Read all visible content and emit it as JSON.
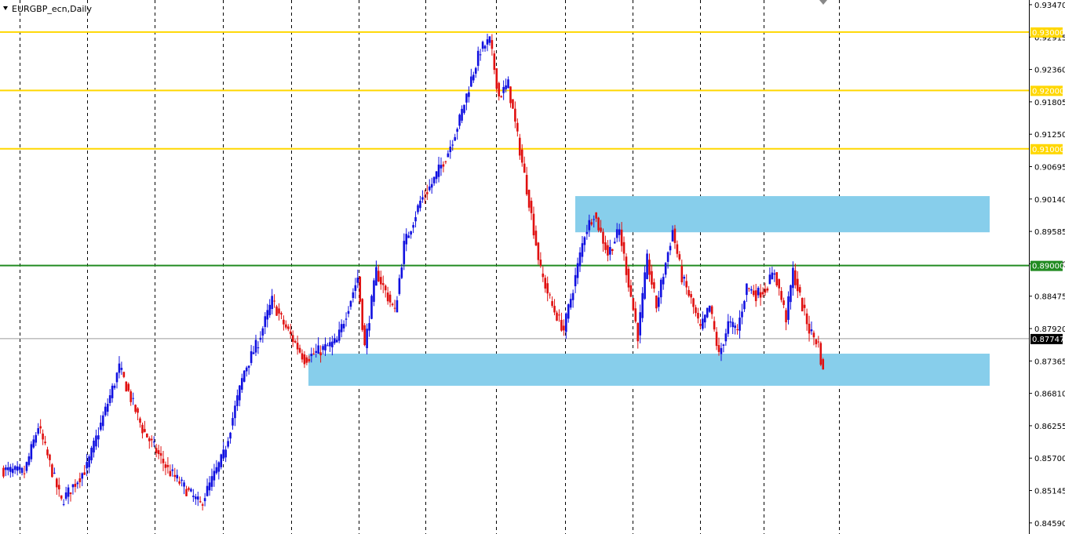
{
  "window": {
    "title": "EURGBP_ecn,Daily"
  },
  "colors": {
    "bull": "#1010e0",
    "bear": "#e01010",
    "zone": "#87ceeb",
    "level_yellow": "#ffd700",
    "level_green": "#228b22",
    "grid": "#000000",
    "current_tag": "#000000"
  },
  "chart_data": {
    "type": "candlestick",
    "symbol": "EURGBP_ecn",
    "timeframe": "Daily",
    "ylim": [
      0.844,
      0.9355
    ],
    "y_ticks": [
      "0.93470",
      "0.92915",
      "0.92360",
      "0.91805",
      "0.91250",
      "0.90695",
      "0.90140",
      "0.89585",
      "0.89030",
      "0.88475",
      "0.87920",
      "0.87365",
      "0.86810",
      "0.86255",
      "0.85700",
      "0.85145",
      "0.84590"
    ],
    "grid_vertical": "dashed",
    "levels": [
      {
        "price": 0.93,
        "label": "0.93000",
        "color": "#ffd700"
      },
      {
        "price": 0.92,
        "label": "0.92000",
        "color": "#ffd700"
      },
      {
        "price": 0.91,
        "label": "0.91000",
        "color": "#ffd700"
      },
      {
        "price": 0.89,
        "label": "0.89000",
        "color": "#228b22"
      }
    ],
    "zones": [
      {
        "from": 0.8957,
        "to": 0.9019
      },
      {
        "from": 0.8694,
        "to": 0.8749
      }
    ],
    "current_price": {
      "value": 0.87747,
      "label": "0.87747"
    },
    "anchors": [
      [
        0,
        0.855
      ],
      [
        10,
        0.8545
      ],
      [
        16,
        0.8625
      ],
      [
        26,
        0.8495
      ],
      [
        37,
        0.8555
      ],
      [
        51,
        0.8725
      ],
      [
        61,
        0.862
      ],
      [
        72,
        0.855
      ],
      [
        86,
        0.849
      ],
      [
        96,
        0.8575
      ],
      [
        105,
        0.872
      ],
      [
        111,
        0.877
      ],
      [
        117,
        0.884
      ],
      [
        122,
        0.88
      ],
      [
        131,
        0.874
      ],
      [
        145,
        0.877
      ],
      [
        154,
        0.888
      ],
      [
        157,
        0.876
      ],
      [
        162,
        0.889
      ],
      [
        170,
        0.882
      ],
      [
        174,
        0.8935
      ],
      [
        181,
        0.901
      ],
      [
        186,
        0.904
      ],
      [
        193,
        0.9095
      ],
      [
        198,
        0.915
      ],
      [
        203,
        0.922
      ],
      [
        207,
        0.927
      ],
      [
        211,
        0.9285
      ],
      [
        215,
        0.919
      ],
      [
        219,
        0.921
      ],
      [
        223,
        0.912
      ],
      [
        228,
        0.901
      ],
      [
        233,
        0.889
      ],
      [
        238,
        0.883
      ],
      [
        243,
        0.879
      ],
      [
        248,
        0.888
      ],
      [
        252,
        0.8955
      ],
      [
        256,
        0.899
      ],
      [
        262,
        0.892
      ],
      [
        267,
        0.896
      ],
      [
        271,
        0.887
      ],
      [
        275,
        0.878
      ],
      [
        279,
        0.891
      ],
      [
        283,
        0.883
      ],
      [
        290,
        0.896
      ],
      [
        294,
        0.888
      ],
      [
        298,
        0.884
      ],
      [
        302,
        0.879
      ],
      [
        306,
        0.883
      ],
      [
        310,
        0.8745
      ],
      [
        314,
        0.88
      ],
      [
        318,
        0.879
      ],
      [
        322,
        0.8865
      ],
      [
        326,
        0.885
      ],
      [
        330,
        0.886
      ],
      [
        334,
        0.889
      ],
      [
        339,
        0.881
      ],
      [
        342,
        0.889
      ],
      [
        346,
        0.883
      ],
      [
        349,
        0.879
      ],
      [
        353,
        0.8765
      ],
      [
        355,
        0.8715
      ]
    ]
  }
}
